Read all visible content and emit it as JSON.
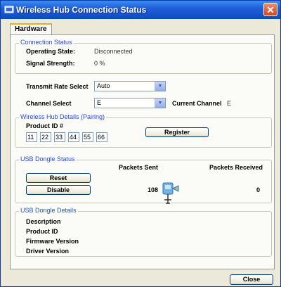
{
  "window": {
    "title": "Wireless Hub Connection Status",
    "close_glyph": "✕"
  },
  "tabs": [
    {
      "label": "Hardware"
    }
  ],
  "connection_status": {
    "title": "Connection Status",
    "operating_state_label": "Operating State:",
    "operating_state_value": "Disconnected",
    "signal_strength_label": "Signal Strength:",
    "signal_strength_value": "0 %"
  },
  "transmit_rate": {
    "label": "Transmit Rate Select",
    "value": "Auto"
  },
  "channel": {
    "label": "Channel Select",
    "value": "E",
    "current_label": "Current Channel",
    "current_value": "E"
  },
  "hub_details": {
    "title": "Wireless Hub Details (Pairing)",
    "product_id_label": "Product ID #",
    "product_id": [
      "11",
      "22",
      "33",
      "44",
      "55",
      "66"
    ],
    "register_label": "Register"
  },
  "usb_status": {
    "title": "USB Dongle Status",
    "packets_sent_label": "Packets Sent",
    "packets_received_label": "Packets Received",
    "packets_sent_value": "108",
    "packets_received_value": "0",
    "reset_label": "Reset",
    "disable_label": "Disable",
    "icon": "usb-dongle-icon"
  },
  "usb_details": {
    "title": "USB Dongle Details",
    "description_label": "Description",
    "product_id_label": "Product ID",
    "firmware_label": "Firmware Version",
    "driver_label": "Driver Version"
  },
  "footer": {
    "close_label": "Close"
  },
  "colors": {
    "titlebar": "#1f5fd8",
    "group_title": "#2850c8",
    "panel": "#fbfbf8"
  }
}
